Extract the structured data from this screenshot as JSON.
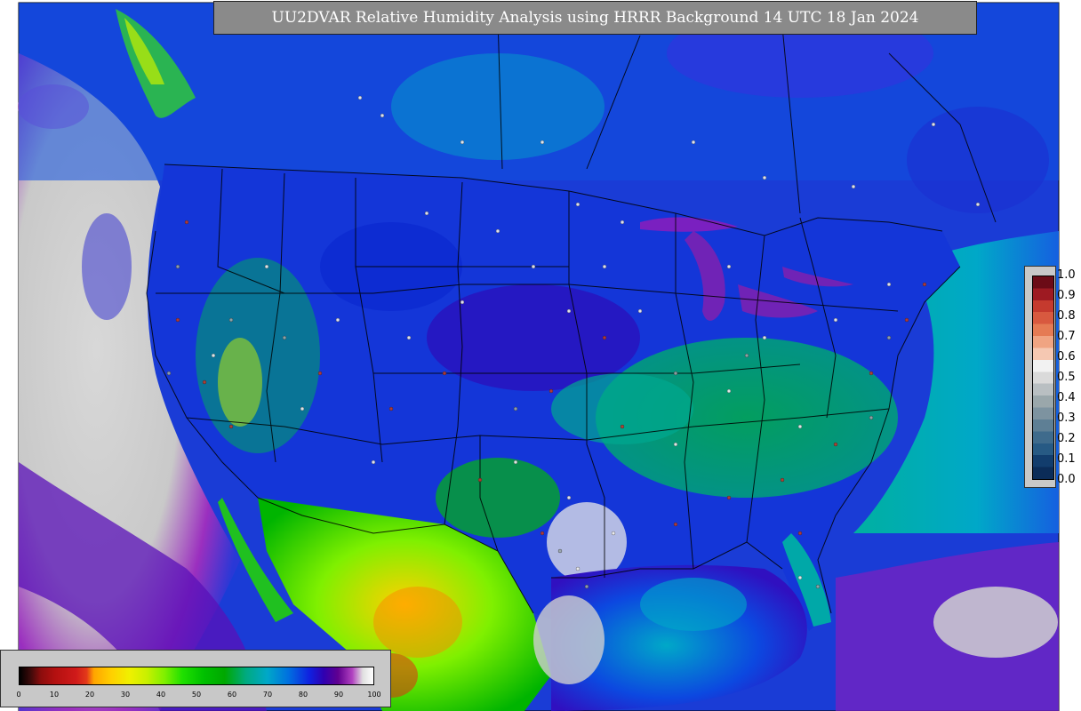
{
  "title": "UU2DVAR Relative Humidity Analysis using HRRR Background 14 UTC 18 Jan 2024",
  "residual_colorbar": {
    "ticks": [
      "1.0",
      "0.9",
      "0.8",
      "0.7",
      "0.6",
      "0.5",
      "0.4",
      "0.3",
      "0.2",
      "0.1",
      "0.0"
    ],
    "colors": [
      "#6b0b16",
      "#9e1a22",
      "#c53a2e",
      "#d8593f",
      "#e57b54",
      "#f0a482",
      "#f5c8b2",
      "#f2f2f2",
      "#dadada",
      "#b9bfc2",
      "#9aa7ab",
      "#7d93a0",
      "#5e7f95",
      "#3f6b8c",
      "#275a84",
      "#123d6d",
      "#0b2c58"
    ]
  },
  "rh_colorbar": {
    "ticks": [
      "0",
      "10",
      "20",
      "30",
      "40",
      "50",
      "60",
      "70",
      "80",
      "90",
      "100"
    ],
    "stops": [
      [
        "#000000",
        0
      ],
      [
        "#3a0a0a",
        3
      ],
      [
        "#8b0d0d",
        6
      ],
      [
        "#b31010",
        10
      ],
      [
        "#d01a1a",
        16
      ],
      [
        "#e33a1a",
        19
      ],
      [
        "#ffa500",
        21
      ],
      [
        "#ffd000",
        26
      ],
      [
        "#f0f000",
        31
      ],
      [
        "#c8f000",
        36
      ],
      [
        "#7ff000",
        41
      ],
      [
        "#20e000",
        46
      ],
      [
        "#00c000",
        52
      ],
      [
        "#00a800",
        58
      ],
      [
        "#00aa80",
        64
      ],
      [
        "#00a8c8",
        70
      ],
      [
        "#0070e0",
        76
      ],
      [
        "#1020e0",
        82
      ],
      [
        "#3000b0",
        86
      ],
      [
        "#600090",
        90
      ],
      [
        "#b040c0",
        94
      ],
      [
        "#e0e0e0",
        97
      ],
      [
        "#ffffff",
        100
      ]
    ]
  },
  "colors": {
    "ocean_deep": "#1a3dd8",
    "ocean_mid": "#1565e0",
    "land_blue": "#1a3cd6",
    "pacific_gray": "#d3d3d3",
    "atl_teal": "#00a8a0",
    "boundary": "#000000"
  }
}
